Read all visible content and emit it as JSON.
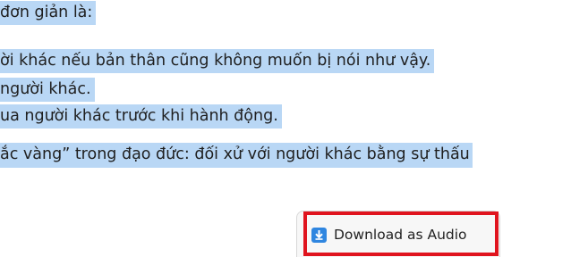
{
  "article": {
    "lines": [
      " đơn giản là:",
      "ời khác nếu bản thân cũng không muốn bị nói như vậy.",
      "người khác.",
      "ua người khác trước khi hành động.",
      "ắc vàng” trong đạo đức: đối xử với người khác bằng sự thấu"
    ]
  },
  "download": {
    "label": "Download as Audio",
    "icon": "download-arrow-icon"
  },
  "colors": {
    "selection": "#b9d7f5",
    "highlight_border": "#e0141e",
    "icon_blue": "#2f86e0"
  }
}
